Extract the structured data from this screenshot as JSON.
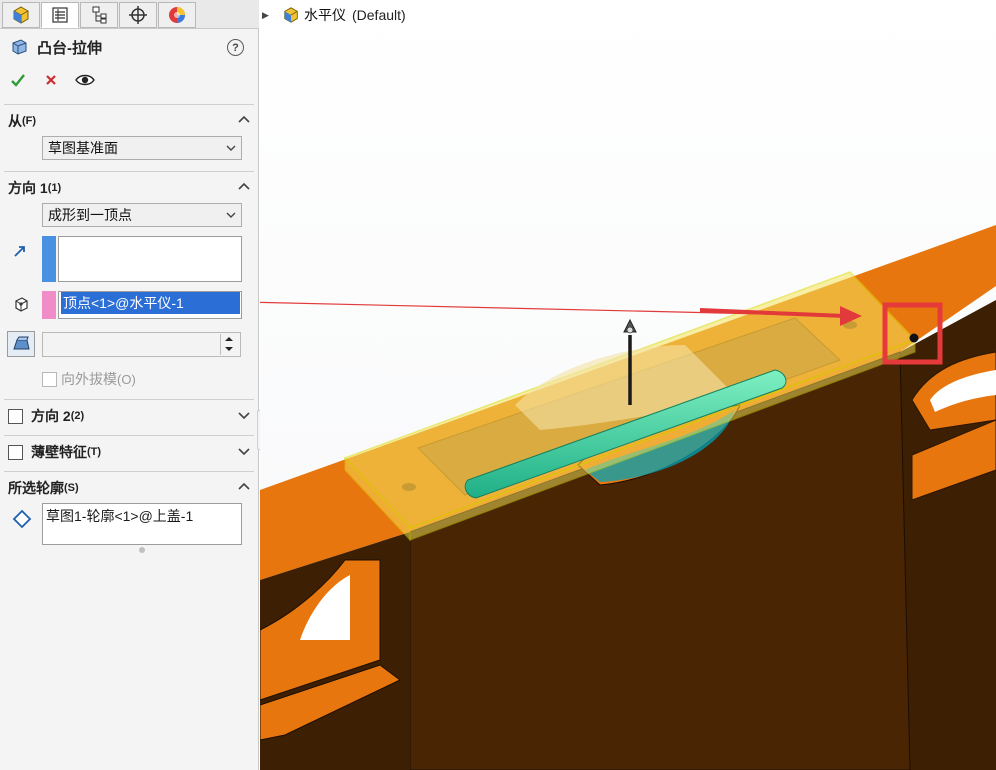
{
  "tabs": [
    {
      "name": "feature-manager",
      "icon": "part-cube-icon"
    },
    {
      "name": "property-manager",
      "icon": "list-icon"
    },
    {
      "name": "configuration-manager",
      "icon": "config-tree-icon"
    },
    {
      "name": "dimxpert-manager",
      "icon": "crosshair-icon"
    },
    {
      "name": "display-manager",
      "icon": "appearance-ball-icon"
    }
  ],
  "feature": {
    "title": "凸台-拉伸",
    "help": "?",
    "confirm_icon": "checkmark-icon",
    "cancel_icon": "cross-icon",
    "preview_icon": "eye-icon"
  },
  "from": {
    "header": "从",
    "header_key": "(F)",
    "value": "草图基准面"
  },
  "direction1": {
    "header": "方向 1",
    "header_key": "(1)",
    "end_condition": "成形到一顶点",
    "vertex_value": "顶点<1>@水平仪-1",
    "draft_outward_label": "向外拔模",
    "draft_outward_key": "(O)"
  },
  "direction2": {
    "header": "方向 2",
    "header_key": "(2)"
  },
  "thin_feature": {
    "header": "薄壁特征",
    "header_key": "(T)"
  },
  "selected_contours": {
    "header": "所选轮廓",
    "header_key": "(S)",
    "value": "草图1-轮廓<1>@上盖-1"
  },
  "tree": {
    "part_name": "水平仪",
    "config": "(Default)"
  },
  "colors": {
    "accent_blue": "#4a90e2",
    "swatch_pink": "#f08cc8",
    "selection_blue": "#2b6fd6",
    "highlight_red": "#e63a3a",
    "model_orange": "#e8760e",
    "model_dark": "#4a2504",
    "preview_yellow": "#f6e45c",
    "rod_green": "#3ed49a"
  }
}
